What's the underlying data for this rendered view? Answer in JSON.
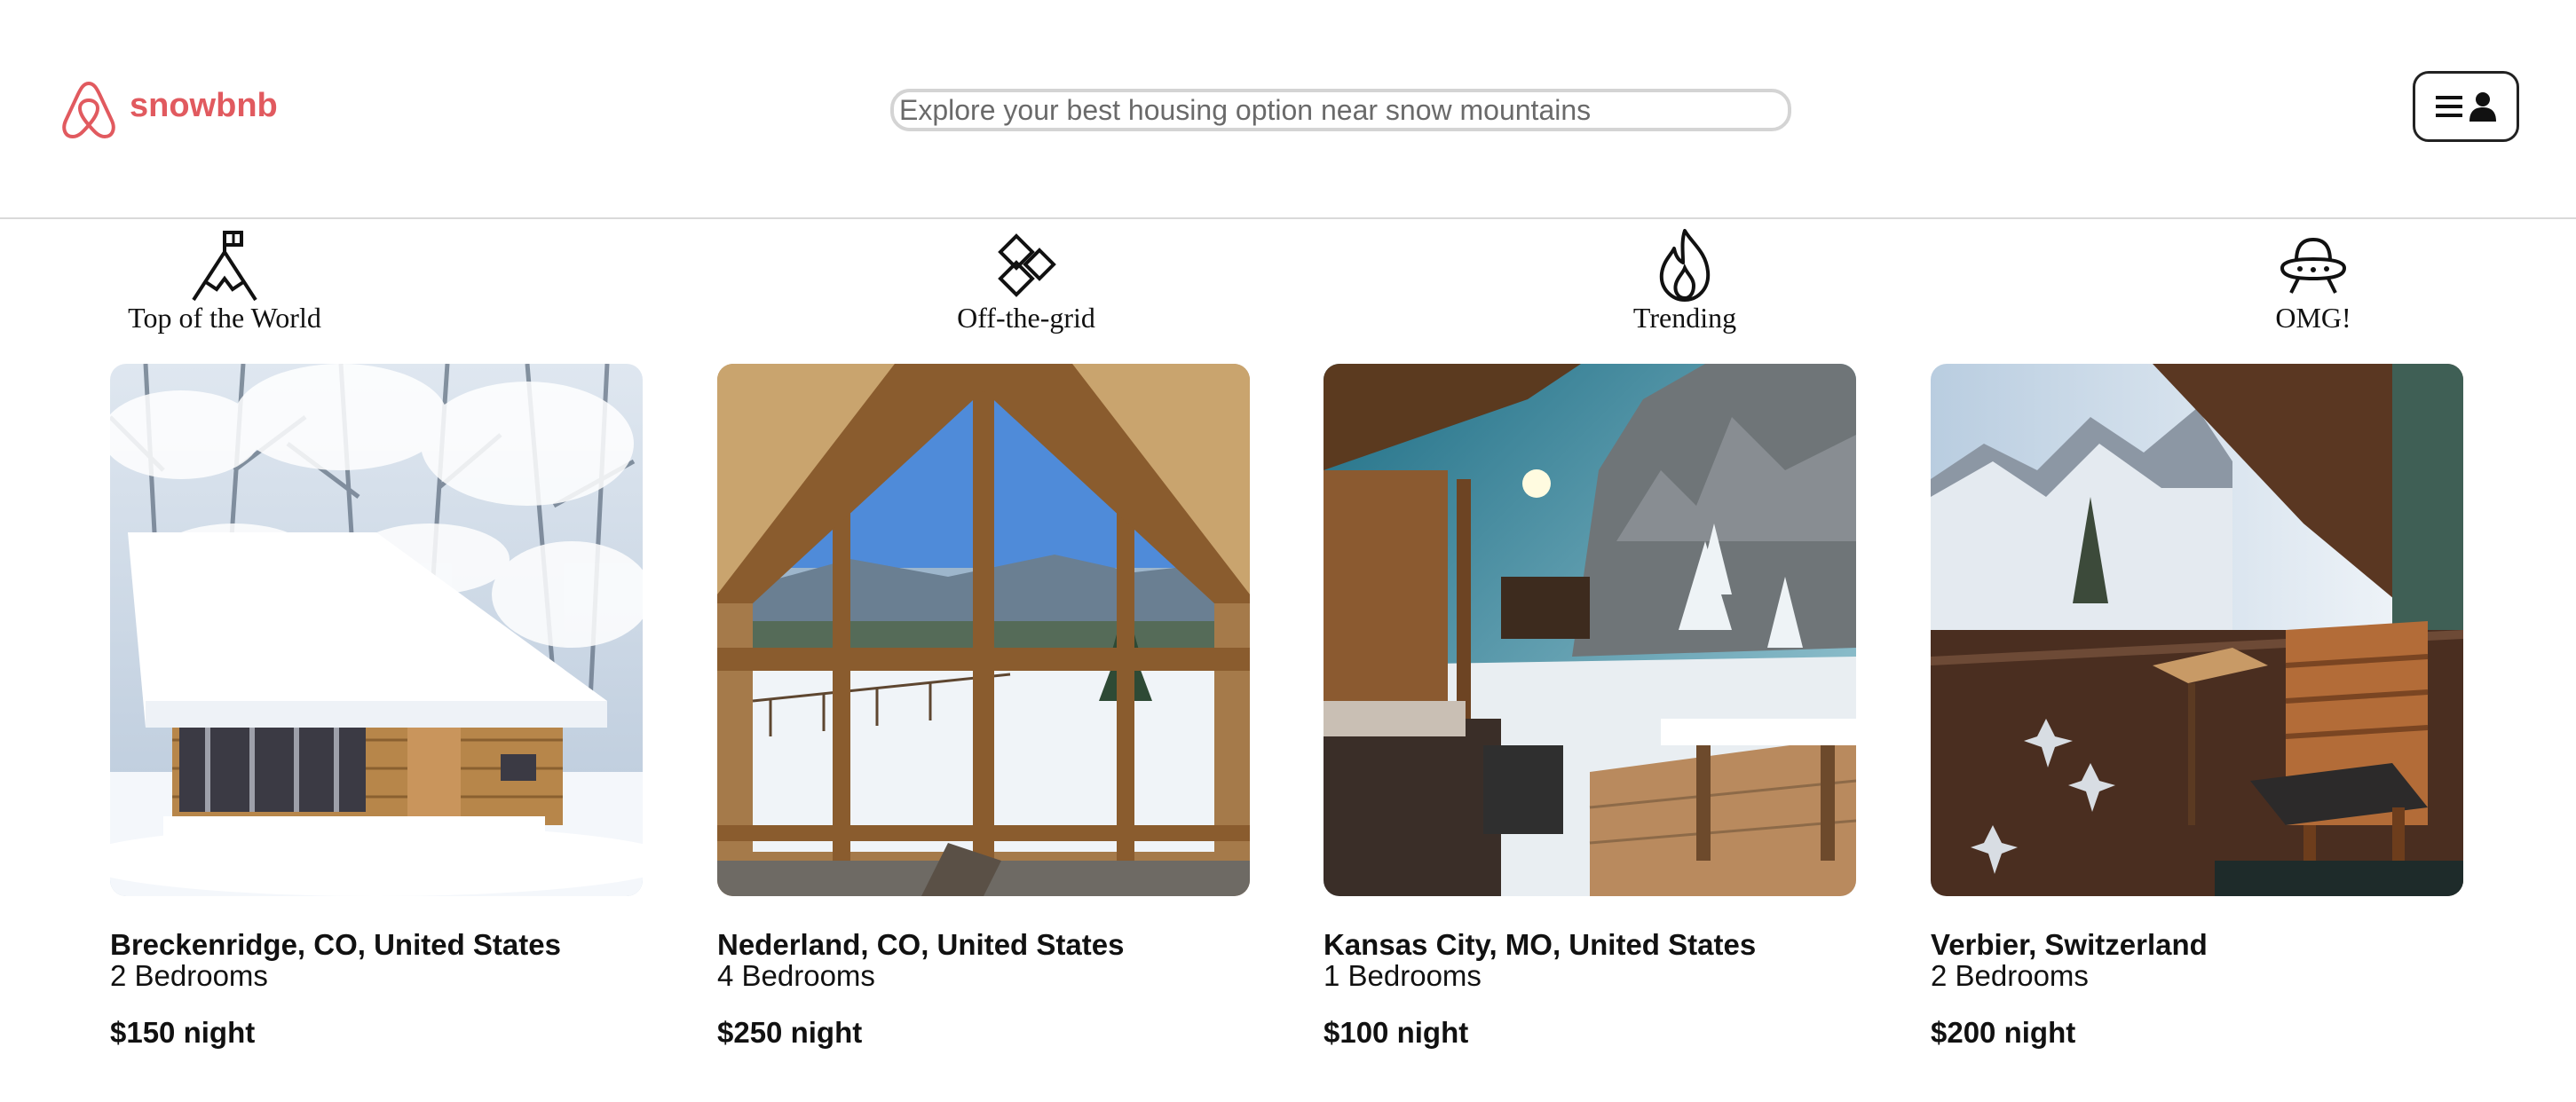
{
  "brand": {
    "name": "snowbnb",
    "color": "#e15a5f"
  },
  "search": {
    "placeholder": "Explore your best housing option near snow mountains"
  },
  "user_menu": {
    "icons": [
      "hamburger-icon",
      "user-icon"
    ]
  },
  "categories": [
    {
      "label": "Top of the World",
      "icon": "mountain-flag-icon"
    },
    {
      "label": "Off-the-grid",
      "icon": "diamonds-icon"
    },
    {
      "label": "Trending",
      "icon": "flame-icon"
    },
    {
      "label": "OMG!",
      "icon": "ufo-icon"
    }
  ],
  "listings": [
    {
      "location": "Breckenridge, CO, United States",
      "bedrooms": "2 Bedrooms",
      "price": "$150 night",
      "image": "snow-covered-cabin-photo"
    },
    {
      "location": "Nederland, CO, United States",
      "bedrooms": "4 Bedrooms",
      "price": "$250 night",
      "image": "a-frame-window-mountain-view-photo"
    },
    {
      "location": "Kansas City, MO, United States",
      "bedrooms": "1 Bedrooms",
      "price": "$100 night",
      "image": "snowy-terrace-cliff-photo"
    },
    {
      "location": "Verbier, Switzerland",
      "bedrooms": "2 Bedrooms",
      "price": "$200 night",
      "image": "balcony-alps-view-photo"
    }
  ]
}
